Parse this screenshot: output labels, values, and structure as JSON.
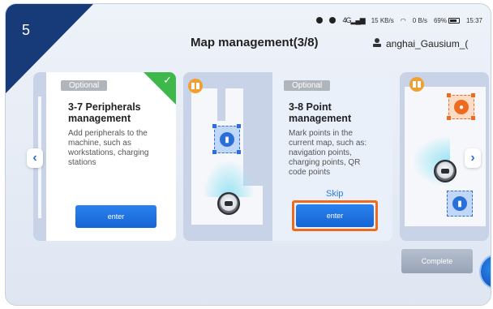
{
  "step": {
    "number": "5"
  },
  "status_bar": {
    "signal": "4G",
    "net_speed_1": "15 KB/s",
    "net_speed_2": "0 B/s",
    "battery": "69%",
    "time": "15:37"
  },
  "header": {
    "title": "Map management(3/8)",
    "user": "anghai_Gausium_("
  },
  "cards": {
    "left": {
      "tag": "Optional",
      "title_line1": "3-7  Peripherals",
      "title_line2": "management",
      "desc": [
        "Add peripherals to the",
        "machine, such as",
        "workstations, charging",
        "stations"
      ],
      "button": "enter"
    },
    "middle": {
      "tag": "Optional",
      "title_line1": "3-8  Point",
      "title_line2": "management",
      "desc": [
        "Mark points in the",
        "current map, such as:",
        "navigation points,",
        "charging points, QR",
        "code points"
      ],
      "skip": "Skip",
      "button": "enter"
    }
  },
  "footer": {
    "complete": "Complete"
  },
  "colors": {
    "accent": "#1664d4",
    "highlight": "#ee6a1e",
    "done": "#3fb84a",
    "corner": "#173a78"
  }
}
